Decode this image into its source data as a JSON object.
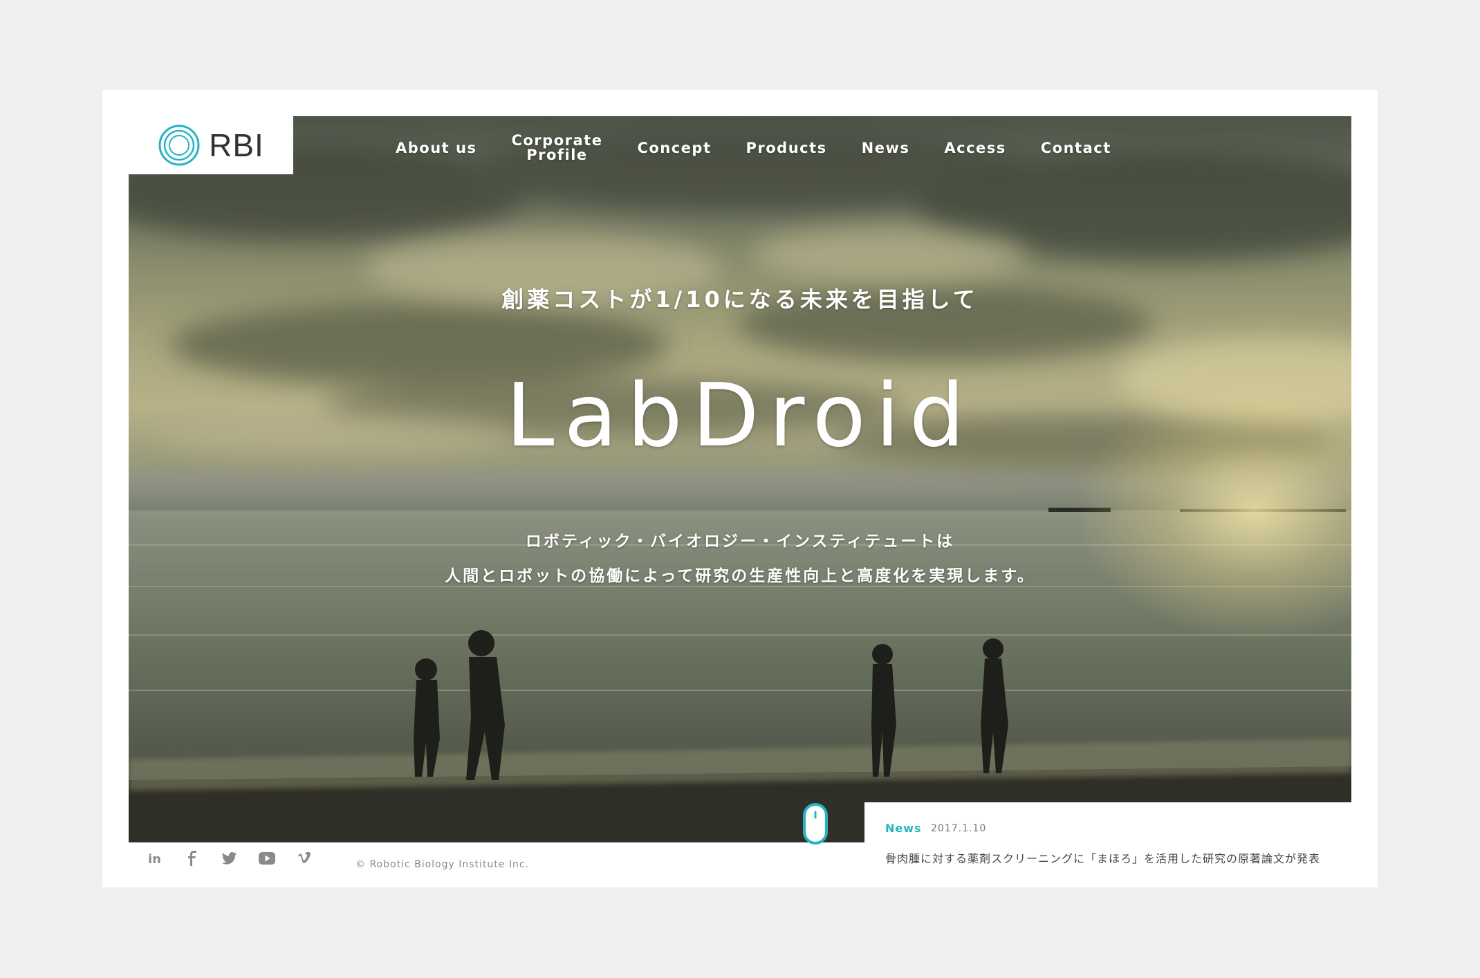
{
  "brand": {
    "logo_text": "RBI",
    "accent_color": "#23b4c2"
  },
  "nav": {
    "items": [
      {
        "label": "About us"
      },
      {
        "label": "Corporate\nProfile"
      },
      {
        "label": "Concept"
      },
      {
        "label": "Products"
      },
      {
        "label": "News"
      },
      {
        "label": "Access"
      },
      {
        "label": "Contact"
      }
    ]
  },
  "hero": {
    "tagline": "創薬コストが1/10になる未来を目指して",
    "headline": "LabDroid",
    "description_line1": "ロボティック・バイオロジー・インスティテュートは",
    "description_line2": "人間とロボットの協働によって研究の生産性向上と高度化を実現します。"
  },
  "footer": {
    "social_icons": [
      "linkedin-icon",
      "facebook-icon",
      "twitter-icon",
      "youtube-icon",
      "vimeo-icon"
    ],
    "copyright": "© Robotic Biology Institute Inc."
  },
  "news": {
    "label": "News",
    "date": "2017.1.10",
    "headline": "骨肉腫に対する薬剤スクリーニングに「まほろ」を活用した研究の原著論文が発表"
  }
}
